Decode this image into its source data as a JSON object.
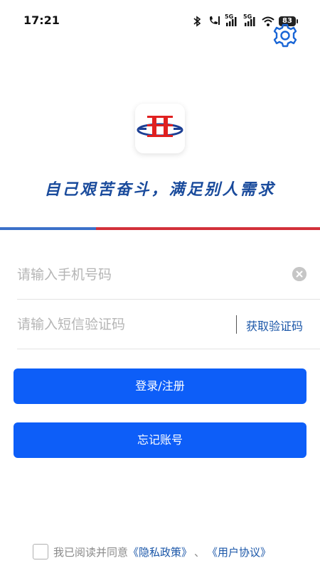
{
  "status_bar": {
    "time": "17:21",
    "network_1": "5G",
    "network_2": "5G",
    "battery": "83",
    "icons": [
      "bluetooth-icon",
      "hd-call-icon",
      "signal-icon",
      "signal-icon",
      "wifi-icon",
      "battery-icon"
    ]
  },
  "header": {
    "settings_icon": "gear-icon"
  },
  "brand": {
    "logo_icon": "company-logo",
    "slogan": "自己艰苦奋斗，满足别人需求",
    "colors": {
      "blue": "#1a4b9c",
      "red": "#d2303a"
    }
  },
  "form": {
    "phone_placeholder": "请输入手机号码",
    "phone_value": "",
    "code_placeholder": "请输入短信验证码",
    "code_value": "",
    "get_code_label": "获取验证码",
    "clear_icon": "clear-icon"
  },
  "actions": {
    "login_label": "登录/注册",
    "forgot_label": "忘记账号",
    "primary_color": "#0d5ef8"
  },
  "agreement": {
    "checked": false,
    "prefix": "我已阅读并同意",
    "privacy_link": "《隐私政策》",
    "separator": "、",
    "user_link": "《用户协议》"
  }
}
